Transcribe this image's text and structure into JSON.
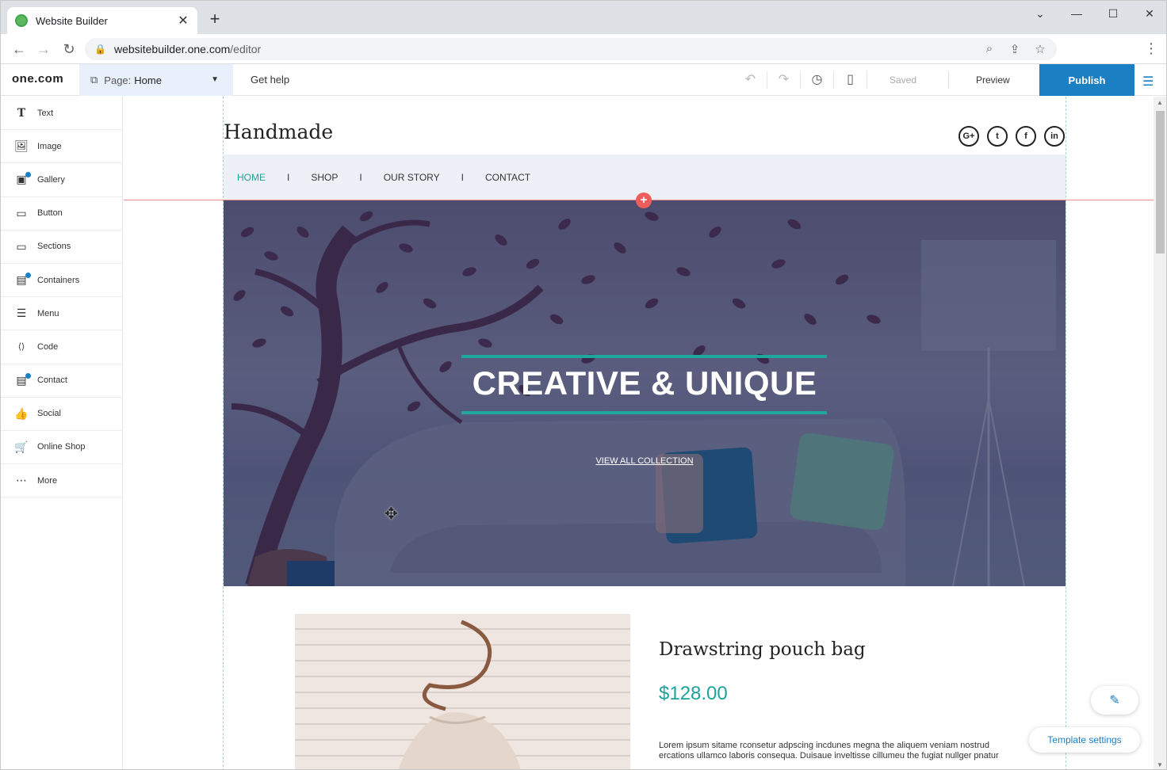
{
  "browser": {
    "tab_title": "Website Builder",
    "tab_close": "✕",
    "new_tab": "+",
    "url_host": "websitebuilder.one.com",
    "url_path": "/editor",
    "window_controls": [
      "⌄",
      "—",
      "☐",
      "✕"
    ]
  },
  "editor": {
    "logo": "one.com",
    "page_label": "Page:",
    "page_value": "Home",
    "get_help": "Get help",
    "saved": "Saved",
    "preview": "Preview",
    "publish": "Publish"
  },
  "sidebar": {
    "items": [
      {
        "label": "Text",
        "icon": "T"
      },
      {
        "label": "Image",
        "icon": "🖼"
      },
      {
        "label": "Gallery",
        "icon": "▣"
      },
      {
        "label": "Button",
        "icon": "▭"
      },
      {
        "label": "Sections",
        "icon": "▭"
      },
      {
        "label": "Containers",
        "icon": "▤"
      },
      {
        "label": "Menu",
        "icon": "☰"
      },
      {
        "label": "Code",
        "icon": "⟨⟩"
      },
      {
        "label": "Contact",
        "icon": "▤"
      },
      {
        "label": "Social",
        "icon": "👍"
      },
      {
        "label": "Online Shop",
        "icon": "🛒"
      },
      {
        "label": "More",
        "icon": "⋯"
      }
    ]
  },
  "site": {
    "title": "Handmade",
    "socials": [
      "G+",
      "t",
      "f",
      "in"
    ],
    "nav": {
      "home": "HOME",
      "shop": "SHOP",
      "our_story": "OUR STORY",
      "contact": "CONTACT",
      "separator": "I"
    },
    "hero": {
      "title": "CREATIVE & UNIQUE",
      "link": "VIEW ALL COLLECTION"
    },
    "product": {
      "name": "Drawstring pouch bag",
      "price": "$128.00",
      "description": "Lorem ipsum sitame rconsetur adpscing incdunes megna the aliquem veniam nostrud ercations ullamco laboris consequa. Duisaue inveltisse cillumeu the fugiat nullger pnatur"
    },
    "template_settings": "Template settings"
  },
  "colors": {
    "accent": "#1b7fc4",
    "teal": "#1aa39b",
    "hero_overlay": "#525a7a",
    "add_button": "#ef5c5c"
  }
}
